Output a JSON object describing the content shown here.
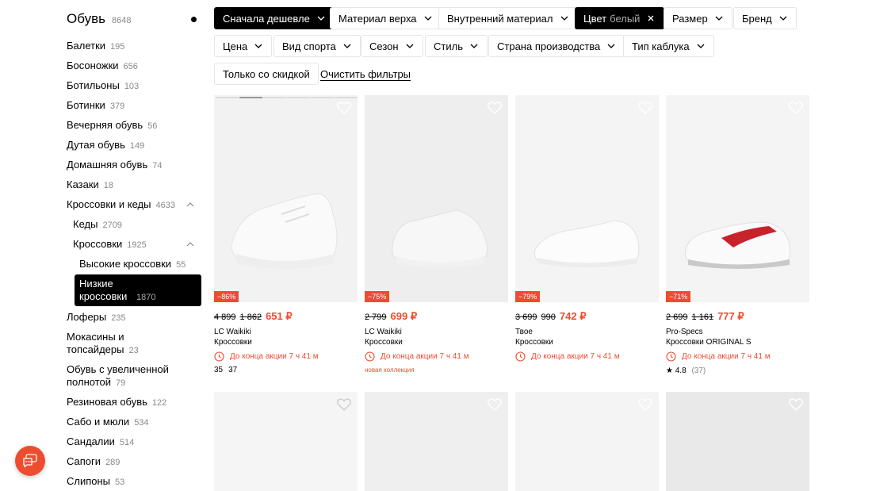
{
  "sidebar": {
    "title": "Обувь",
    "title_count": "8648",
    "items": [
      {
        "label": "Балетки",
        "count": "195"
      },
      {
        "label": "Босоножки",
        "count": "656"
      },
      {
        "label": "Ботильоны",
        "count": "103"
      },
      {
        "label": "Ботинки",
        "count": "379"
      },
      {
        "label": "Вечерняя обувь",
        "count": "56"
      },
      {
        "label": "Дутая обувь",
        "count": "149"
      },
      {
        "label": "Домашняя обувь",
        "count": "74"
      },
      {
        "label": "Казаки",
        "count": "18"
      },
      {
        "label": "Кроссовки и кеды",
        "count": "4633"
      },
      {
        "label": "Кеды",
        "count": "2709"
      },
      {
        "label": "Кроссовки",
        "count": "1925"
      },
      {
        "label": "Высокие кроссовки",
        "count": "55"
      },
      {
        "label": "Низкие кроссовки",
        "count": "1870"
      },
      {
        "label": "Лоферы",
        "count": "235"
      },
      {
        "label": "Мокасины и топсайдеры",
        "count": "23"
      },
      {
        "label": "Обувь с увеличенной полнотой",
        "count": "79"
      },
      {
        "label": "Резиновая обувь",
        "count": "122"
      },
      {
        "label": "Сабо и мюли",
        "count": "534"
      },
      {
        "label": "Сандалии",
        "count": "514"
      },
      {
        "label": "Сапоги",
        "count": "289"
      },
      {
        "label": "Слипоны",
        "count": "53"
      }
    ]
  },
  "filters": {
    "sort": "Сначала дешевле",
    "upper_material": "Материал верха",
    "inner_material": "Внутренний материал",
    "color": "Цвет",
    "color_value": "белый",
    "size": "Размер",
    "brand": "Бренд",
    "price": "Цена",
    "sport": "Вид спорта",
    "season": "Сезон",
    "style": "Стиль",
    "country": "Страна производства",
    "heel": "Тип каблука",
    "discount_only": "Только со скидкой",
    "clear": "Очистить фильтры"
  },
  "products": [
    {
      "badge": "−86%",
      "old1": "4 899",
      "old2": "1 862",
      "price": "651 ₽",
      "brand": "LC Waikiki",
      "type": "Кроссовки",
      "promo": "До конца акции 7 ч 41 м",
      "size1": "35",
      "size2": "37"
    },
    {
      "badge": "−75%",
      "old1": "2 799",
      "price": "699 ₽",
      "brand": "LC Waikiki",
      "type": "Кроссовки",
      "promo": "До конца акции 7 ч 41 м",
      "note": "новая коллекция"
    },
    {
      "badge": "−79%",
      "old1": "3 699",
      "old2": "990",
      "price": "742 ₽",
      "brand": "Твое",
      "type": "Кроссовки",
      "promo": "До конца акции 7 ч 41 м"
    },
    {
      "badge": "−71%",
      "old1": "2 699",
      "old2": "1 161",
      "price": "777 ₽",
      "brand": "Pro-Specs",
      "type": "Кроссовки ORIGINAL S",
      "promo": "До конца акции 7 ч 41 м",
      "rating": "4.8",
      "reviews": "(37)"
    }
  ],
  "colors": {
    "accent": "#ee4c2f",
    "dark": "#000000",
    "muted": "#888888"
  },
  "icons": {
    "favorite": "heart-icon",
    "timer": "clock-icon",
    "chat": "chat-icon",
    "dropdown": "chevron-down-icon",
    "close": "close-icon"
  }
}
